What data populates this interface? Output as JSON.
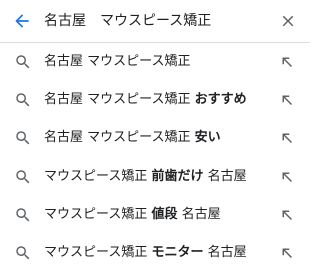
{
  "search": {
    "query": "名古屋　マウスピース矯正"
  },
  "icons": {
    "back": "arrow-left-icon",
    "clear": "close-icon",
    "suggestion": "search-icon",
    "fill": "arrow-up-left-icon"
  },
  "colors": {
    "accent": "#1a73e8",
    "icon": "#5f6368",
    "divider": "#dadce0"
  },
  "suggestions": [
    {
      "base": "名古屋 マウスピース矯正",
      "bold": "",
      "tail": ""
    },
    {
      "base": "名古屋 マウスピース矯正 ",
      "bold": "おすすめ",
      "tail": ""
    },
    {
      "base": "名古屋 マウスピース矯正 ",
      "bold": "安い",
      "tail": ""
    },
    {
      "base": "マウスピース矯正 ",
      "bold": "前歯だけ",
      "tail": " 名古屋"
    },
    {
      "base": "マウスピース矯正 ",
      "bold": "値段",
      "tail": " 名古屋"
    },
    {
      "base": "マウスピース矯正 ",
      "bold": "モニター",
      "tail": " 名古屋"
    }
  ]
}
